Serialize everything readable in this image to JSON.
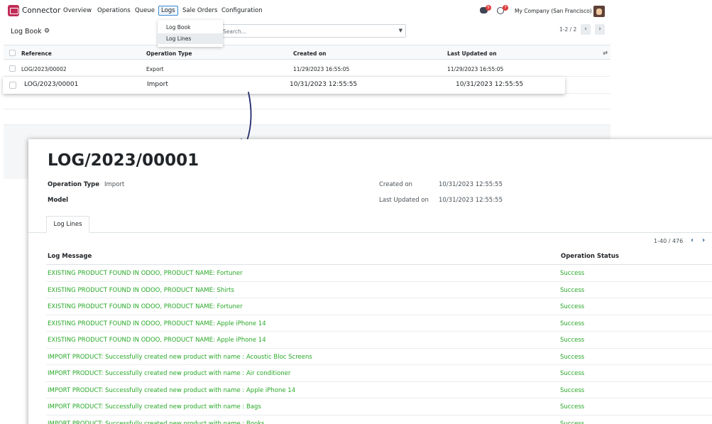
{
  "app": {
    "name": "Connector",
    "menus": [
      "Overview",
      "Operations",
      "Queue",
      "Logs",
      "Sale Orders",
      "Configuration"
    ],
    "company": "My Company (San Francisco)",
    "chat_badge": "5",
    "activity_badge": "7"
  },
  "dropdown": {
    "items": [
      "Log Book",
      "Log Lines"
    ]
  },
  "list": {
    "breadcrumb": "Log Book",
    "search_placeholder": "Search...",
    "pager": "1-2 / 2",
    "headers": [
      "Reference",
      "Operation Type",
      "Created on",
      "Last Updated on"
    ],
    "rows": [
      {
        "reference": "LOG/2023/00002",
        "type": "Export",
        "created": "11/29/2023 16:55:05",
        "updated": "11/29/2023 16:55:05"
      },
      {
        "reference": "LOG/2023/00001",
        "type": "Import",
        "created": "10/31/2023 12:55:55",
        "updated": "10/31/2023 12:55:55"
      }
    ]
  },
  "detail": {
    "title": "LOG/2023/00001",
    "operation_type_label": "Operation Type",
    "operation_type": "Import",
    "model_label": "Model",
    "created_label": "Created on",
    "created": "10/31/2023 12:55:55",
    "updated_label": "Last Updated on",
    "updated": "10/31/2023 12:55:55",
    "tab": "Log Lines",
    "pager": "1-40 / 476",
    "col_message": "Log Message",
    "col_status": "Operation Status",
    "lines": [
      {
        "message": "EXISTING PRODUCT FOUND IN ODOO, PRODUCT NAME: Fortuner",
        "status": "Success"
      },
      {
        "message": "EXISTING PRODUCT FOUND IN ODOO, PRODUCT NAME: Shirts",
        "status": "Success"
      },
      {
        "message": "EXISTING PRODUCT FOUND IN ODOO, PRODUCT NAME: Fortuner",
        "status": "Success"
      },
      {
        "message": "EXISTING PRODUCT FOUND IN ODOO, PRODUCT NAME: Apple iPhone 14",
        "status": "Success"
      },
      {
        "message": "EXISTING PRODUCT FOUND IN ODOO, PRODUCT NAME: Apple iPhone 14",
        "status": "Success"
      },
      {
        "message": "IMPORT PRODUCT: Successfully created new product with name : Acoustic Bloc Screens",
        "status": "Success"
      },
      {
        "message": "IMPORT PRODUCT: Successfully created new product with name : Air conditioner",
        "status": "Success"
      },
      {
        "message": "IMPORT PRODUCT: Successfully created new product with name : Apple iPhone 14",
        "status": "Success"
      },
      {
        "message": "IMPORT PRODUCT: Successfully created new product with name : Bags",
        "status": "Success"
      },
      {
        "message": "IMPORT PRODUCT: Successfully created new product with name : Books",
        "status": "Success"
      }
    ]
  },
  "colors": {
    "accent": "#c02c57",
    "success": "#28a828",
    "link": "#1f4b8f"
  }
}
